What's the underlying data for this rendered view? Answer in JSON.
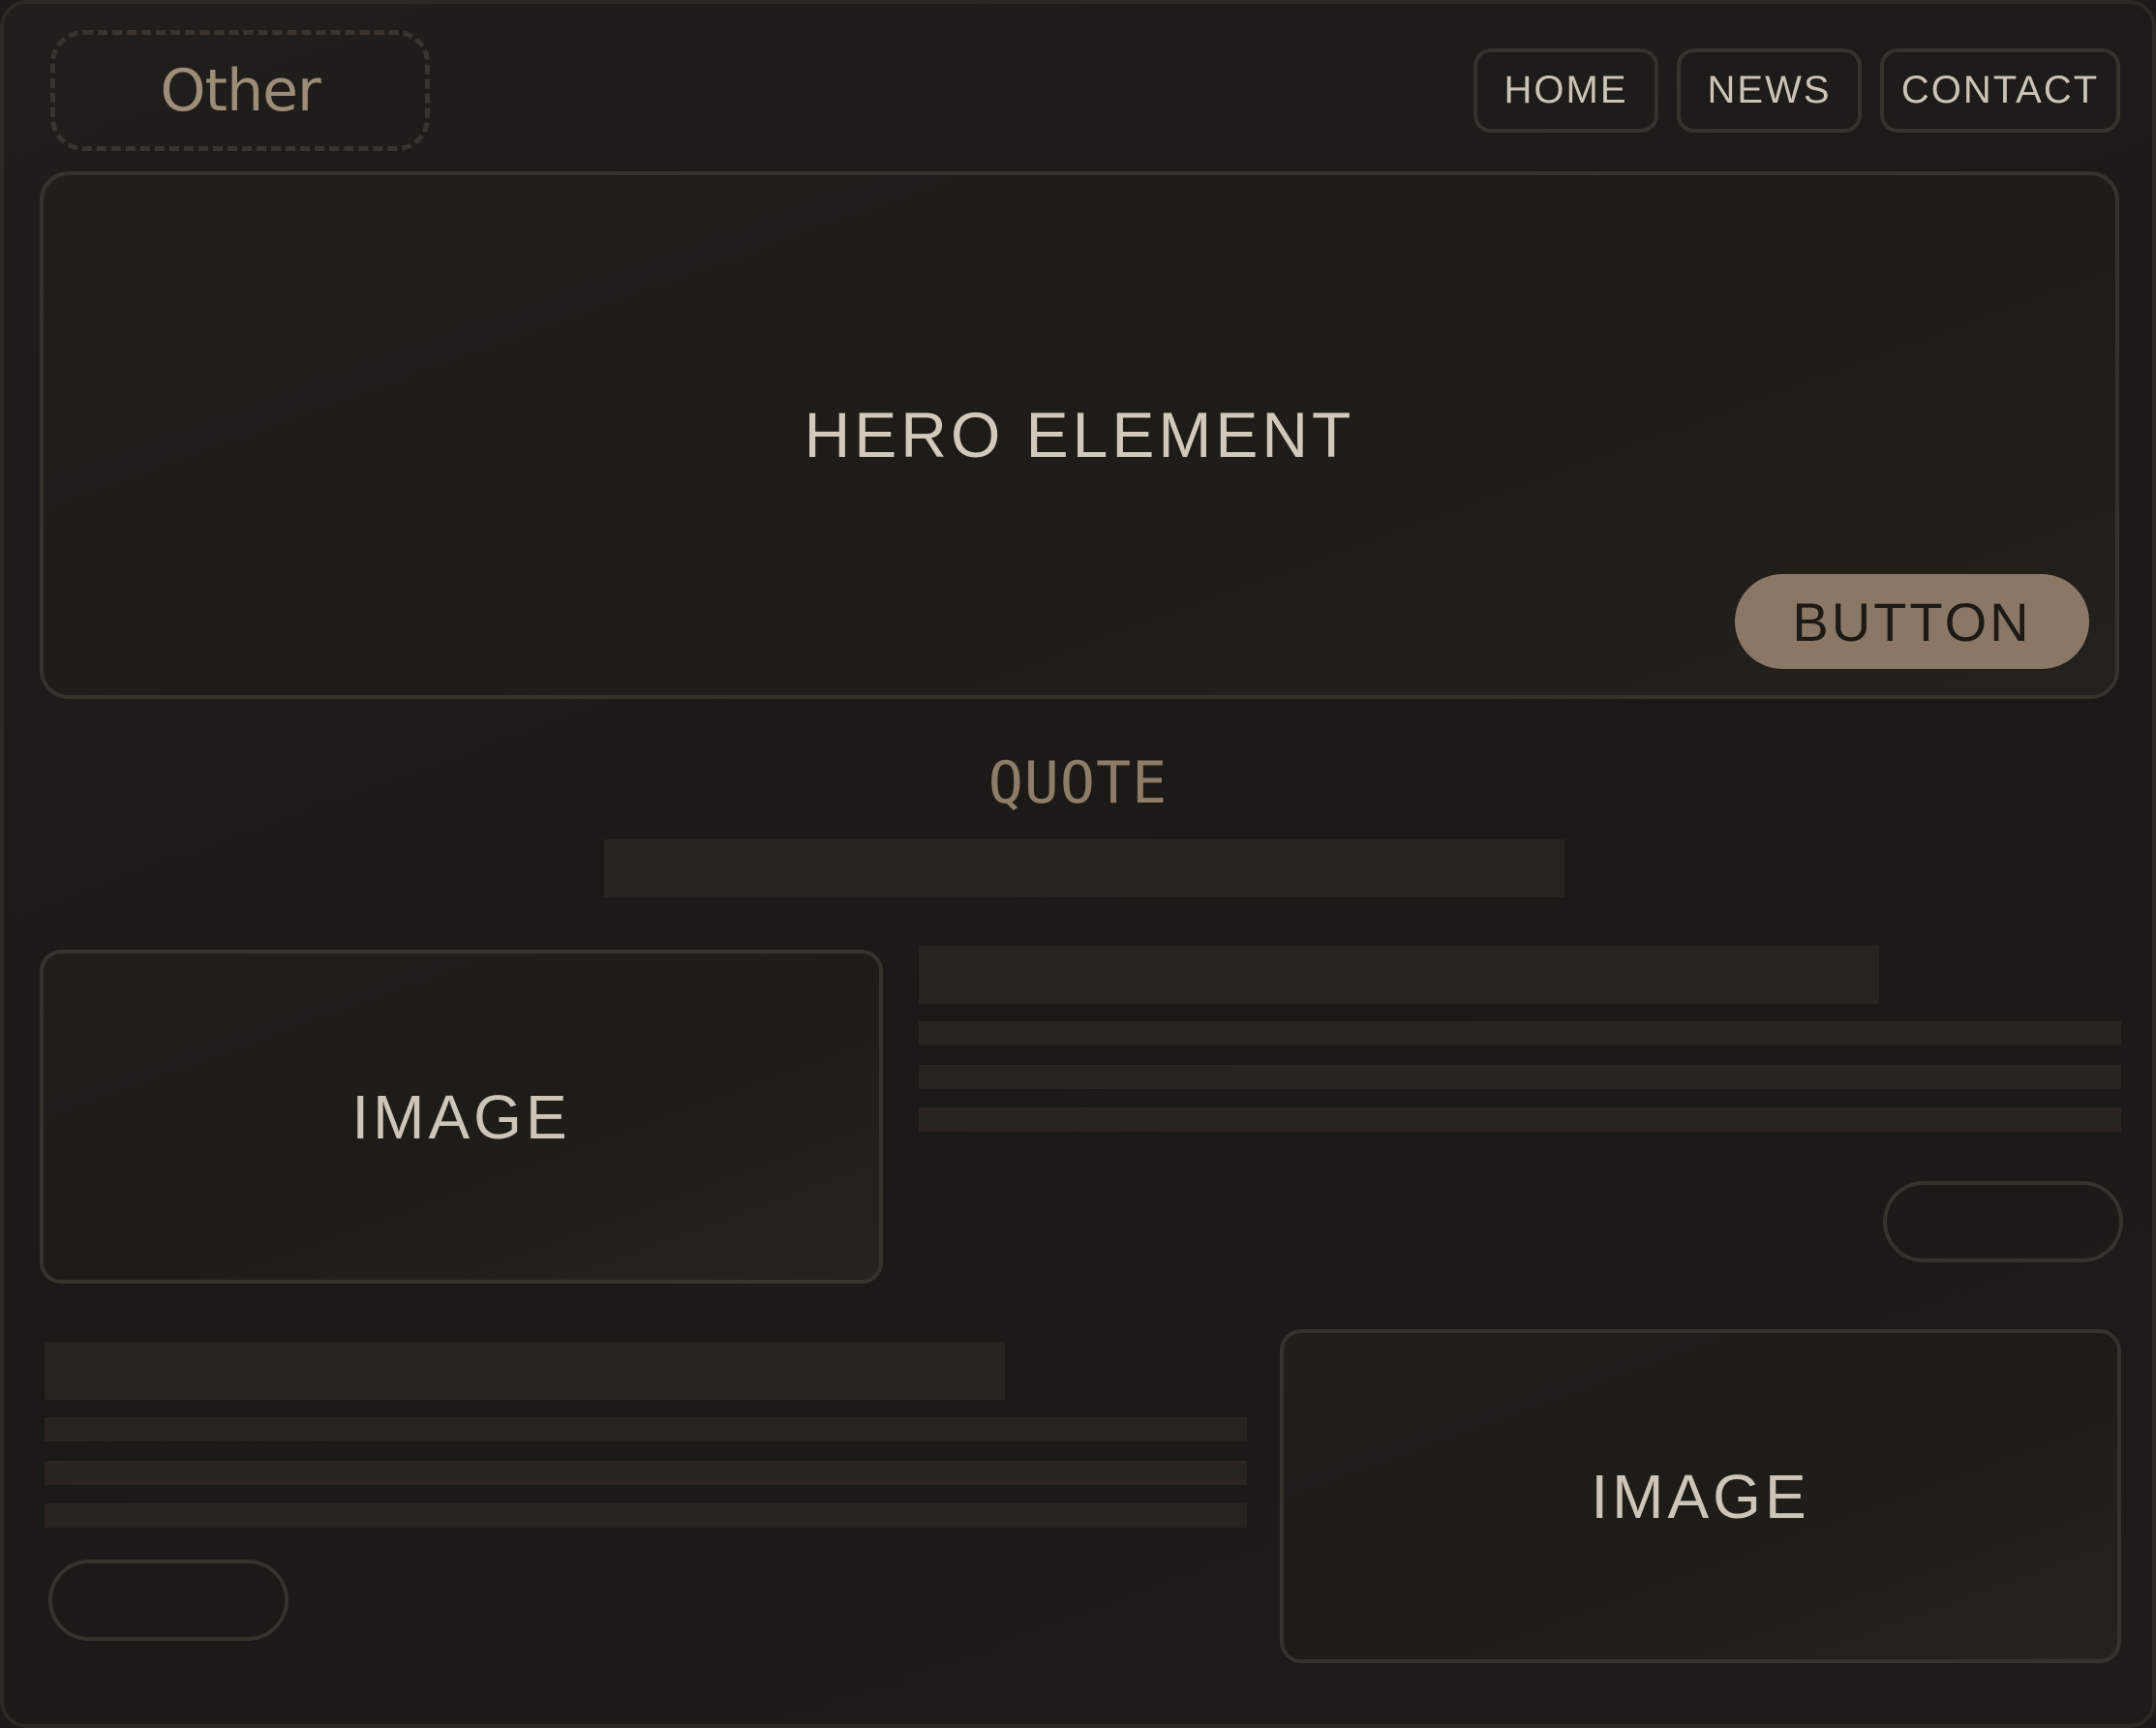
{
  "header": {
    "logo_text": "Other",
    "nav": [
      {
        "label": "HOME"
      },
      {
        "label": "NEWS"
      },
      {
        "label": "CONTACT"
      }
    ]
  },
  "hero": {
    "title": "HERO ELEMENT",
    "button_label": "BUTTON"
  },
  "quote": {
    "label": "QUOTE"
  },
  "sections": [
    {
      "image_label": "IMAGE"
    },
    {
      "image_label": "IMAGE"
    }
  ],
  "colors": {
    "background": "#1c1a16",
    "accent": "#8a7765",
    "border": "#36322c",
    "text": "#d2c9bd",
    "muted": "#8e7c68"
  }
}
